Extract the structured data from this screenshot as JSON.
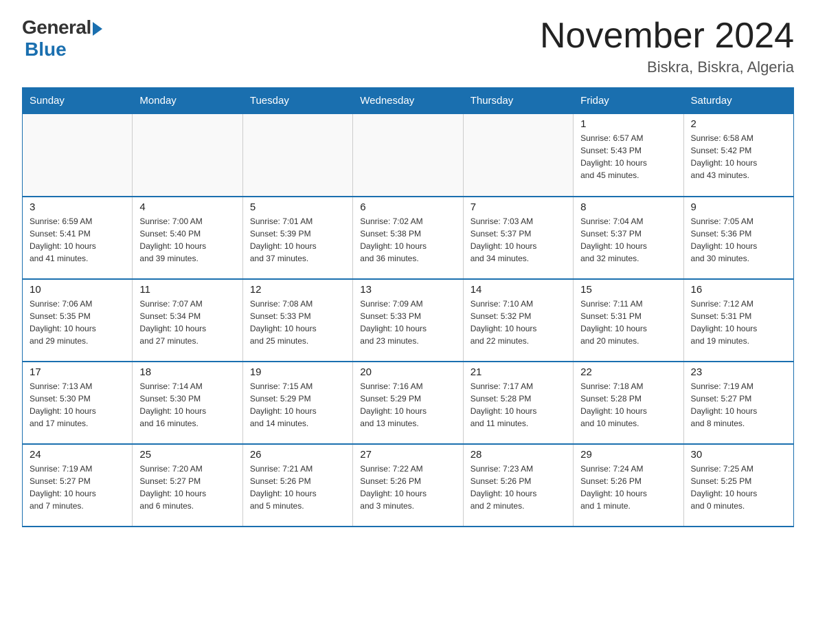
{
  "header": {
    "logo_general": "General",
    "logo_blue": "Blue",
    "month_year": "November 2024",
    "location": "Biskra, Biskra, Algeria"
  },
  "days_of_week": [
    "Sunday",
    "Monday",
    "Tuesday",
    "Wednesday",
    "Thursday",
    "Friday",
    "Saturday"
  ],
  "weeks": [
    [
      {
        "day": "",
        "info": ""
      },
      {
        "day": "",
        "info": ""
      },
      {
        "day": "",
        "info": ""
      },
      {
        "day": "",
        "info": ""
      },
      {
        "day": "",
        "info": ""
      },
      {
        "day": "1",
        "info": "Sunrise: 6:57 AM\nSunset: 5:43 PM\nDaylight: 10 hours\nand 45 minutes."
      },
      {
        "day": "2",
        "info": "Sunrise: 6:58 AM\nSunset: 5:42 PM\nDaylight: 10 hours\nand 43 minutes."
      }
    ],
    [
      {
        "day": "3",
        "info": "Sunrise: 6:59 AM\nSunset: 5:41 PM\nDaylight: 10 hours\nand 41 minutes."
      },
      {
        "day": "4",
        "info": "Sunrise: 7:00 AM\nSunset: 5:40 PM\nDaylight: 10 hours\nand 39 minutes."
      },
      {
        "day": "5",
        "info": "Sunrise: 7:01 AM\nSunset: 5:39 PM\nDaylight: 10 hours\nand 37 minutes."
      },
      {
        "day": "6",
        "info": "Sunrise: 7:02 AM\nSunset: 5:38 PM\nDaylight: 10 hours\nand 36 minutes."
      },
      {
        "day": "7",
        "info": "Sunrise: 7:03 AM\nSunset: 5:37 PM\nDaylight: 10 hours\nand 34 minutes."
      },
      {
        "day": "8",
        "info": "Sunrise: 7:04 AM\nSunset: 5:37 PM\nDaylight: 10 hours\nand 32 minutes."
      },
      {
        "day": "9",
        "info": "Sunrise: 7:05 AM\nSunset: 5:36 PM\nDaylight: 10 hours\nand 30 minutes."
      }
    ],
    [
      {
        "day": "10",
        "info": "Sunrise: 7:06 AM\nSunset: 5:35 PM\nDaylight: 10 hours\nand 29 minutes."
      },
      {
        "day": "11",
        "info": "Sunrise: 7:07 AM\nSunset: 5:34 PM\nDaylight: 10 hours\nand 27 minutes."
      },
      {
        "day": "12",
        "info": "Sunrise: 7:08 AM\nSunset: 5:33 PM\nDaylight: 10 hours\nand 25 minutes."
      },
      {
        "day": "13",
        "info": "Sunrise: 7:09 AM\nSunset: 5:33 PM\nDaylight: 10 hours\nand 23 minutes."
      },
      {
        "day": "14",
        "info": "Sunrise: 7:10 AM\nSunset: 5:32 PM\nDaylight: 10 hours\nand 22 minutes."
      },
      {
        "day": "15",
        "info": "Sunrise: 7:11 AM\nSunset: 5:31 PM\nDaylight: 10 hours\nand 20 minutes."
      },
      {
        "day": "16",
        "info": "Sunrise: 7:12 AM\nSunset: 5:31 PM\nDaylight: 10 hours\nand 19 minutes."
      }
    ],
    [
      {
        "day": "17",
        "info": "Sunrise: 7:13 AM\nSunset: 5:30 PM\nDaylight: 10 hours\nand 17 minutes."
      },
      {
        "day": "18",
        "info": "Sunrise: 7:14 AM\nSunset: 5:30 PM\nDaylight: 10 hours\nand 16 minutes."
      },
      {
        "day": "19",
        "info": "Sunrise: 7:15 AM\nSunset: 5:29 PM\nDaylight: 10 hours\nand 14 minutes."
      },
      {
        "day": "20",
        "info": "Sunrise: 7:16 AM\nSunset: 5:29 PM\nDaylight: 10 hours\nand 13 minutes."
      },
      {
        "day": "21",
        "info": "Sunrise: 7:17 AM\nSunset: 5:28 PM\nDaylight: 10 hours\nand 11 minutes."
      },
      {
        "day": "22",
        "info": "Sunrise: 7:18 AM\nSunset: 5:28 PM\nDaylight: 10 hours\nand 10 minutes."
      },
      {
        "day": "23",
        "info": "Sunrise: 7:19 AM\nSunset: 5:27 PM\nDaylight: 10 hours\nand 8 minutes."
      }
    ],
    [
      {
        "day": "24",
        "info": "Sunrise: 7:19 AM\nSunset: 5:27 PM\nDaylight: 10 hours\nand 7 minutes."
      },
      {
        "day": "25",
        "info": "Sunrise: 7:20 AM\nSunset: 5:27 PM\nDaylight: 10 hours\nand 6 minutes."
      },
      {
        "day": "26",
        "info": "Sunrise: 7:21 AM\nSunset: 5:26 PM\nDaylight: 10 hours\nand 5 minutes."
      },
      {
        "day": "27",
        "info": "Sunrise: 7:22 AM\nSunset: 5:26 PM\nDaylight: 10 hours\nand 3 minutes."
      },
      {
        "day": "28",
        "info": "Sunrise: 7:23 AM\nSunset: 5:26 PM\nDaylight: 10 hours\nand 2 minutes."
      },
      {
        "day": "29",
        "info": "Sunrise: 7:24 AM\nSunset: 5:26 PM\nDaylight: 10 hours\nand 1 minute."
      },
      {
        "day": "30",
        "info": "Sunrise: 7:25 AM\nSunset: 5:25 PM\nDaylight: 10 hours\nand 0 minutes."
      }
    ]
  ]
}
